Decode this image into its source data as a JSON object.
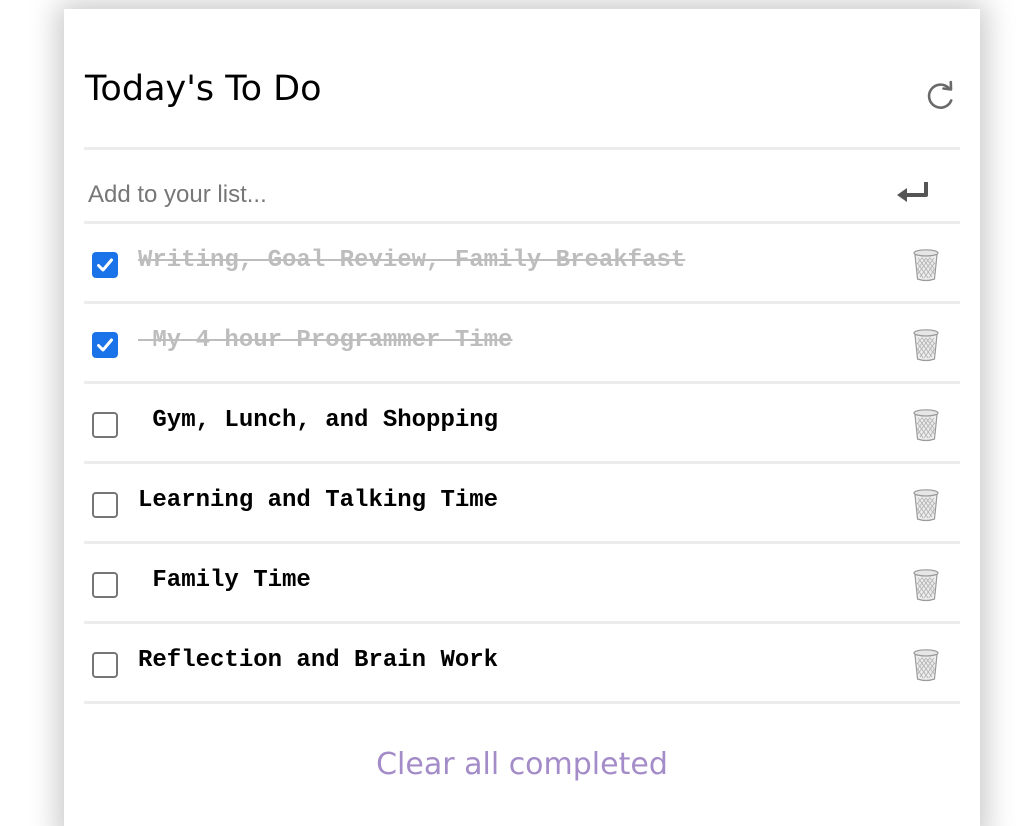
{
  "title": "Today's To Do",
  "icons": {
    "refresh": "refresh-icon",
    "enter": "enter-icon",
    "trash": "trash-icon",
    "check": "checkmark-icon"
  },
  "add_input": {
    "placeholder": "Add to your list...",
    "value": ""
  },
  "items": [
    {
      "text": "Writing, Goal Review, Family Breakfast",
      "checked": true
    },
    {
      "text": " My 4 hour Programmer Time",
      "checked": true
    },
    {
      "text": " Gym, Lunch, and Shopping",
      "checked": false
    },
    {
      "text": "Learning and Talking Time",
      "checked": false
    },
    {
      "text": " Family Time",
      "checked": false
    },
    {
      "text": "Reflection and Brain Work",
      "checked": false
    }
  ],
  "clear_label": "Clear all completed",
  "colors": {
    "checkbox_checked": "#1a73e8",
    "completed_text": "#bdbdbd",
    "clear_link": "#a48cc8",
    "divider": "#ececec"
  }
}
